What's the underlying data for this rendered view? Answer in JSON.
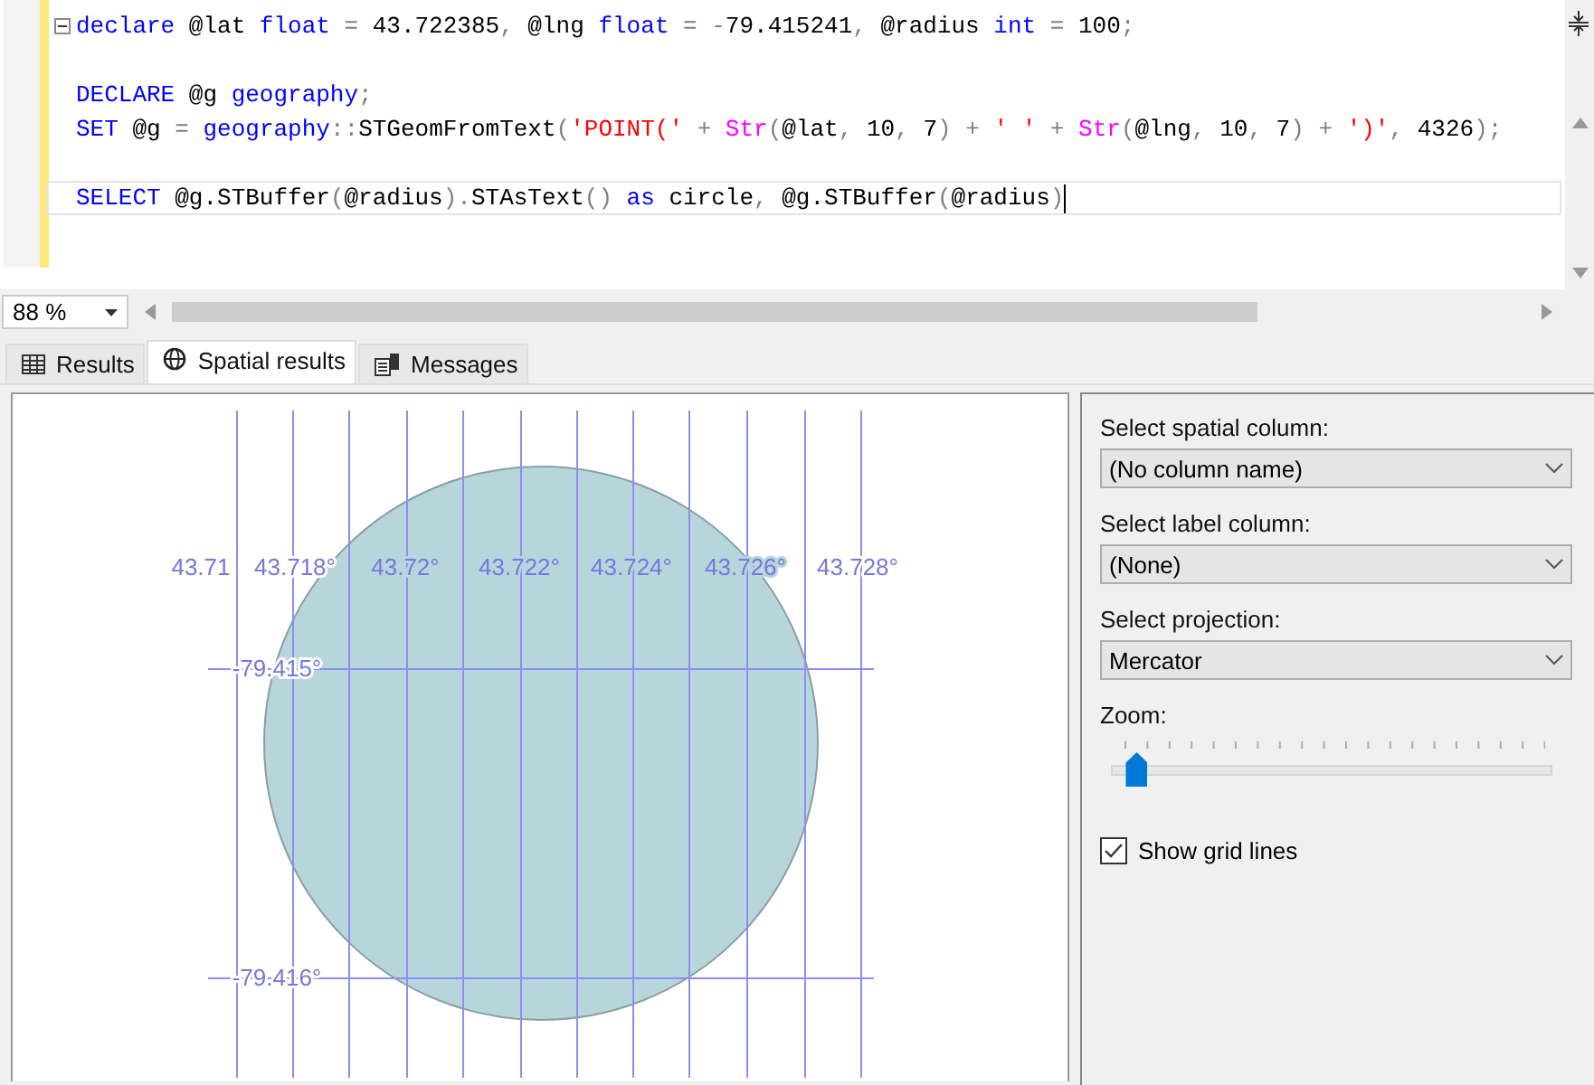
{
  "editor": {
    "lines": [
      {
        "kind": "code",
        "foldable": true,
        "current": false,
        "tokens": [
          {
            "kind": "keyword",
            "text": "declare"
          },
          {
            "kind": "plain",
            "text": " @lat "
          },
          {
            "kind": "keyword",
            "text": "float"
          },
          {
            "kind": "op",
            "text": " = "
          },
          {
            "kind": "plain",
            "text": "43.722385"
          },
          {
            "kind": "op",
            "text": ", "
          },
          {
            "kind": "plain",
            "text": "@lng "
          },
          {
            "kind": "keyword",
            "text": "float"
          },
          {
            "kind": "op",
            "text": " = -"
          },
          {
            "kind": "plain",
            "text": "79.415241"
          },
          {
            "kind": "op",
            "text": ", "
          },
          {
            "kind": "plain",
            "text": "@radius "
          },
          {
            "kind": "keyword",
            "text": "int"
          },
          {
            "kind": "op",
            "text": " = "
          },
          {
            "kind": "plain",
            "text": "100"
          },
          {
            "kind": "op",
            "text": ";"
          }
        ]
      },
      {
        "kind": "blank"
      },
      {
        "kind": "code",
        "foldable": false,
        "current": false,
        "tokens": [
          {
            "kind": "keyword",
            "text": "DECLARE"
          },
          {
            "kind": "plain",
            "text": " @g "
          },
          {
            "kind": "keyword",
            "text": "geography"
          },
          {
            "kind": "op",
            "text": ";"
          }
        ]
      },
      {
        "kind": "code",
        "foldable": false,
        "current": false,
        "tokens": [
          {
            "kind": "keyword",
            "text": "SET"
          },
          {
            "kind": "plain",
            "text": " @g "
          },
          {
            "kind": "op",
            "text": "= "
          },
          {
            "kind": "keyword",
            "text": "geography"
          },
          {
            "kind": "op",
            "text": "::"
          },
          {
            "kind": "plain",
            "text": "STGeomFromText"
          },
          {
            "kind": "op",
            "text": "("
          },
          {
            "kind": "string",
            "text": "'POINT('"
          },
          {
            "kind": "op",
            "text": " + "
          },
          {
            "kind": "function",
            "text": "Str"
          },
          {
            "kind": "op",
            "text": "("
          },
          {
            "kind": "plain",
            "text": "@lat"
          },
          {
            "kind": "op",
            "text": ", "
          },
          {
            "kind": "plain",
            "text": "10"
          },
          {
            "kind": "op",
            "text": ", "
          },
          {
            "kind": "plain",
            "text": "7"
          },
          {
            "kind": "op",
            "text": ") + "
          },
          {
            "kind": "string",
            "text": "' '"
          },
          {
            "kind": "op",
            "text": " + "
          },
          {
            "kind": "function",
            "text": "Str"
          },
          {
            "kind": "op",
            "text": "("
          },
          {
            "kind": "plain",
            "text": "@lng"
          },
          {
            "kind": "op",
            "text": ", "
          },
          {
            "kind": "plain",
            "text": "10"
          },
          {
            "kind": "op",
            "text": ", "
          },
          {
            "kind": "plain",
            "text": "7"
          },
          {
            "kind": "op",
            "text": ") + "
          },
          {
            "kind": "string",
            "text": "')'"
          },
          {
            "kind": "op",
            "text": ", "
          },
          {
            "kind": "plain",
            "text": "4326"
          },
          {
            "kind": "op",
            "text": ");"
          }
        ]
      },
      {
        "kind": "blank"
      },
      {
        "kind": "code",
        "foldable": false,
        "current": true,
        "tokens": [
          {
            "kind": "keyword",
            "text": "SELECT"
          },
          {
            "kind": "plain",
            "text": " @g.STBuffer"
          },
          {
            "kind": "op",
            "text": "("
          },
          {
            "kind": "plain",
            "text": "@radius"
          },
          {
            "kind": "op",
            "text": ")."
          },
          {
            "kind": "plain",
            "text": "STAsText"
          },
          {
            "kind": "op",
            "text": "() "
          },
          {
            "kind": "keyword",
            "text": "as"
          },
          {
            "kind": "plain",
            "text": " circle"
          },
          {
            "kind": "op",
            "text": ", "
          },
          {
            "kind": "plain",
            "text": "@g.STBuffer"
          },
          {
            "kind": "op",
            "text": "("
          },
          {
            "kind": "plain",
            "text": "@radius"
          },
          {
            "kind": "op",
            "text": ")"
          }
        ]
      }
    ]
  },
  "zoom_select": {
    "value": "88 %"
  },
  "tabs": [
    {
      "label": "Results",
      "selected": false
    },
    {
      "label": "Spatial results",
      "selected": true
    },
    {
      "label": "Messages",
      "selected": false
    }
  ],
  "map": {
    "x_labels": [
      "43.71",
      "43.718°",
      "43.72°",
      "43.722°",
      "43.724°",
      "43.726°",
      "43.728°"
    ],
    "y_labels": [
      "-79.415°",
      "-79.416°"
    ]
  },
  "options": {
    "spatial_column": {
      "label": "Select spatial column:",
      "value": "(No column name)"
    },
    "label_column": {
      "label": "Select label column:",
      "value": "(None)"
    },
    "projection": {
      "label": "Select projection:",
      "value": "Mercator"
    },
    "zoom": {
      "label": "Zoom:",
      "level": 0.03
    },
    "grid_lines": {
      "label": "Show grid lines",
      "checked": true
    }
  }
}
